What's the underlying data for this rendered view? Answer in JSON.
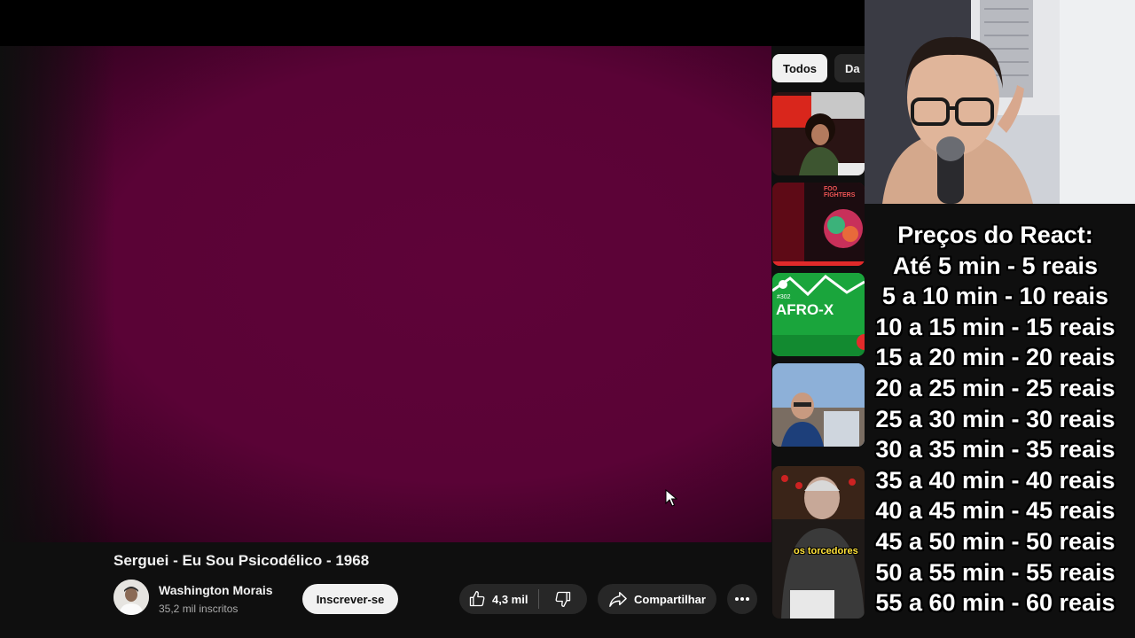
{
  "video": {
    "title": "Serguei - Eu Sou Psicodélico - 1968",
    "channel_name": "Washington Morais",
    "subscribers": "35,2 mil inscritos",
    "subscribe_label": "Inscrever-se",
    "like_count": "4,3 mil",
    "share_label": "Compartilhar"
  },
  "filter_chips": [
    "Todos",
    "Da"
  ],
  "thumbnails": [
    {
      "text": ""
    },
    {
      "text": "FOO FIGHTERS"
    },
    {
      "text": "AFRO-X",
      "badge": "#302"
    },
    {
      "text": ""
    },
    {
      "text": "os torcedores"
    }
  ],
  "overlay": {
    "title": "Preços do React:",
    "prices": [
      "Até 5 min - 5 reais",
      "5 a 10 min - 10 reais",
      "10 a 15 min - 15 reais",
      "15 a 20 min - 20 reais",
      "20 a 25 min - 25 reais",
      "25 a 30 min - 30 reais",
      "30 a 35 min - 35 reais",
      "35 a 40 min - 40 reais",
      "40 a 45 min - 45 reais",
      "45 a 50 min - 50 reais",
      "50 a 55 min - 55 reais",
      "55 a 60 min - 60 reais"
    ]
  },
  "colors": {
    "player_bg": "#5a0336",
    "page_bg": "#0f0f0f",
    "button_bg": "#272727",
    "subscribe_bg": "#f1f1f1"
  }
}
